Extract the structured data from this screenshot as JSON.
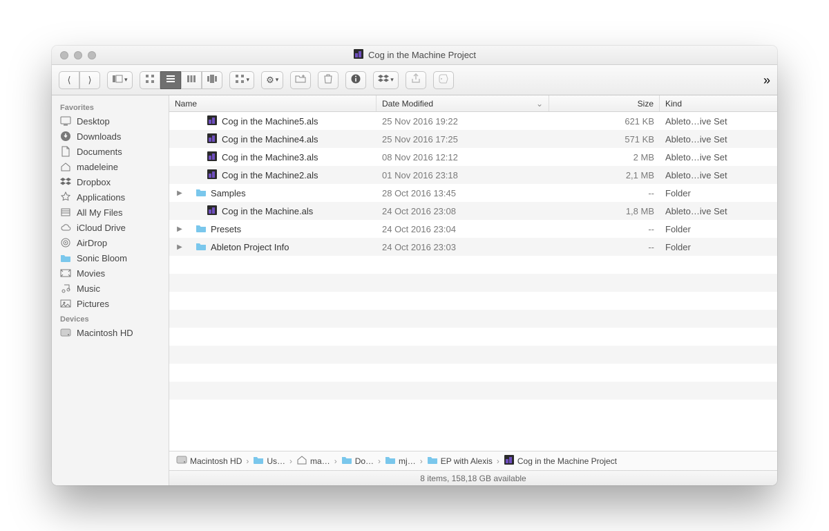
{
  "window": {
    "title": "Cog in the Machine Project"
  },
  "columns": {
    "name": "Name",
    "date": "Date Modified",
    "size": "Size",
    "kind": "Kind"
  },
  "sidebar": {
    "sections": [
      {
        "title": "Favorites",
        "items": [
          {
            "icon": "desktop",
            "label": "Desktop"
          },
          {
            "icon": "downloads",
            "label": "Downloads"
          },
          {
            "icon": "documents",
            "label": "Documents"
          },
          {
            "icon": "home",
            "label": "madeleine"
          },
          {
            "icon": "dropbox",
            "label": "Dropbox"
          },
          {
            "icon": "applications",
            "label": "Applications"
          },
          {
            "icon": "all-my-files",
            "label": "All My Files"
          },
          {
            "icon": "icloud",
            "label": "iCloud Drive"
          },
          {
            "icon": "airdrop",
            "label": "AirDrop"
          },
          {
            "icon": "folder",
            "label": "Sonic Bloom"
          },
          {
            "icon": "movies",
            "label": "Movies"
          },
          {
            "icon": "music",
            "label": "Music"
          },
          {
            "icon": "pictures",
            "label": "Pictures"
          }
        ]
      },
      {
        "title": "Devices",
        "items": [
          {
            "icon": "hd",
            "label": "Macintosh HD"
          }
        ]
      }
    ]
  },
  "files": [
    {
      "type": "als",
      "name": "Cog in the Machine5.als",
      "date": "25 Nov 2016 19:22",
      "size": "621 KB",
      "kind": "Ableto…ive Set",
      "expandable": false
    },
    {
      "type": "als",
      "name": "Cog in the Machine4.als",
      "date": "25 Nov 2016 17:25",
      "size": "571 KB",
      "kind": "Ableto…ive Set",
      "expandable": false
    },
    {
      "type": "als",
      "name": "Cog in the Machine3.als",
      "date": "08 Nov 2016 12:12",
      "size": "2 MB",
      "kind": "Ableto…ive Set",
      "expandable": false
    },
    {
      "type": "als",
      "name": "Cog in the Machine2.als",
      "date": "01 Nov 2016 23:18",
      "size": "2,1 MB",
      "kind": "Ableto…ive Set",
      "expandable": false
    },
    {
      "type": "folder",
      "name": "Samples",
      "date": "28 Oct 2016 13:45",
      "size": "--",
      "kind": "Folder",
      "expandable": true
    },
    {
      "type": "als",
      "name": "Cog in the Machine.als",
      "date": "24 Oct 2016 23:08",
      "size": "1,8 MB",
      "kind": "Ableto…ive Set",
      "expandable": false
    },
    {
      "type": "folder",
      "name": "Presets",
      "date": "24 Oct 2016 23:04",
      "size": "--",
      "kind": "Folder",
      "expandable": true
    },
    {
      "type": "folder",
      "name": "Ableton Project Info",
      "date": "24 Oct 2016 23:03",
      "size": "--",
      "kind": "Folder",
      "expandable": true
    }
  ],
  "blank_rows": 8,
  "path": [
    {
      "icon": "hd",
      "label": "Macintosh HD"
    },
    {
      "icon": "folder",
      "label": "Us…"
    },
    {
      "icon": "home",
      "label": "ma…"
    },
    {
      "icon": "folder",
      "label": "Do…"
    },
    {
      "icon": "folder",
      "label": "mj…"
    },
    {
      "icon": "folder",
      "label": "EP with Alexis"
    },
    {
      "icon": "als",
      "label": "Cog in the Machine Project"
    }
  ],
  "status": "8 items, 158,18 GB available"
}
